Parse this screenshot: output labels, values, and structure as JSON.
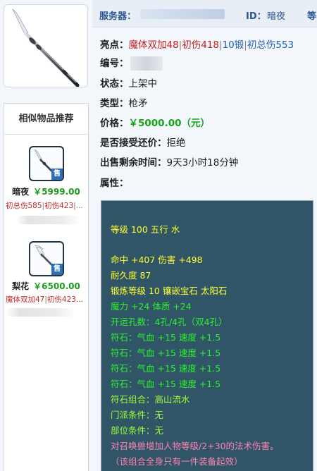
{
  "header": {
    "server_label": "服务器：",
    "id_label": "ID：",
    "id_value": "暗夜",
    "level_label": "等"
  },
  "item": {
    "icon": "spear-weapon-icon",
    "highlights_label": "亮点：",
    "highlights": [
      {
        "text": "魔体双加48",
        "color": "#c4201f"
      },
      {
        "text": "初伤418",
        "color": "#c4201f"
      },
      {
        "text": "10锻",
        "color": "#1d5fb0"
      },
      {
        "text": "初总伤553",
        "color": "#1d5fb0"
      }
    ],
    "serial_label": "编号：",
    "status_label": "状态：",
    "status_value": "上架中",
    "type_label": "类型：",
    "type_value": "枪矛",
    "price_label": "价格：",
    "price_value": "￥5000.00（元）",
    "bargain_label": "是否接受还价：",
    "bargain_value": "拒绝",
    "remaining_label": "出售剩余时间：",
    "remaining_value": "9天3小时18分钟",
    "attrs_label": "属性："
  },
  "stats": [
    {
      "text": "等级 100 五行 水",
      "color": "#ffff33"
    },
    {
      "text": "命中 +407 伤害 +498",
      "color": "#ffff33"
    },
    {
      "text": "耐久度 87",
      "color": "#ffff33"
    },
    {
      "text": "锻炼等级 10 镶嵌宝石 太阳石",
      "color": "#ffff33"
    },
    {
      "text": "魔力 +24 体质 +24",
      "color": "#2ef02e"
    },
    {
      "text": "开运孔数：4孔/4孔（双4孔）",
      "color": "#2ef02e"
    },
    {
      "text": "符石：气血 +15 速度 +1.5",
      "color": "#2ef02e"
    },
    {
      "text": "符石：气血 +15 速度 +1.5",
      "color": "#2ef02e"
    },
    {
      "text": "符石：气血 +15 速度 +1.5",
      "color": "#2ef02e"
    },
    {
      "text": "符石：气血 +15 速度 +1.5",
      "color": "#2ef02e"
    },
    {
      "text": "符石组合：高山流水",
      "color": "#9cff3a"
    },
    {
      "text": "门派条件：无",
      "color": "#9cff3a"
    },
    {
      "text": "部位条件：无",
      "color": "#9cff3a"
    },
    {
      "text": "对召唤兽增加人物等级/2+30的法术伤害。",
      "color": "#ff82b4"
    },
    {
      "text": "（该组合全身只有一件装备起效）",
      "color": "#ff82b4"
    }
  ],
  "similar": {
    "title": "相似物品推荐",
    "sell_tag": "售",
    "items": [
      {
        "name": "暗夜",
        "price": "￥5999.00",
        "tags": [
          "初总伤585",
          "初伤423",
          "..."
        ],
        "icon": "spear-weapon-icon"
      },
      {
        "name": "梨花",
        "price": "￥6500.00",
        "tags": [
          "魔体双加47",
          "初伤423..."
        ],
        "icon": "spear-weapon-icon"
      }
    ]
  }
}
